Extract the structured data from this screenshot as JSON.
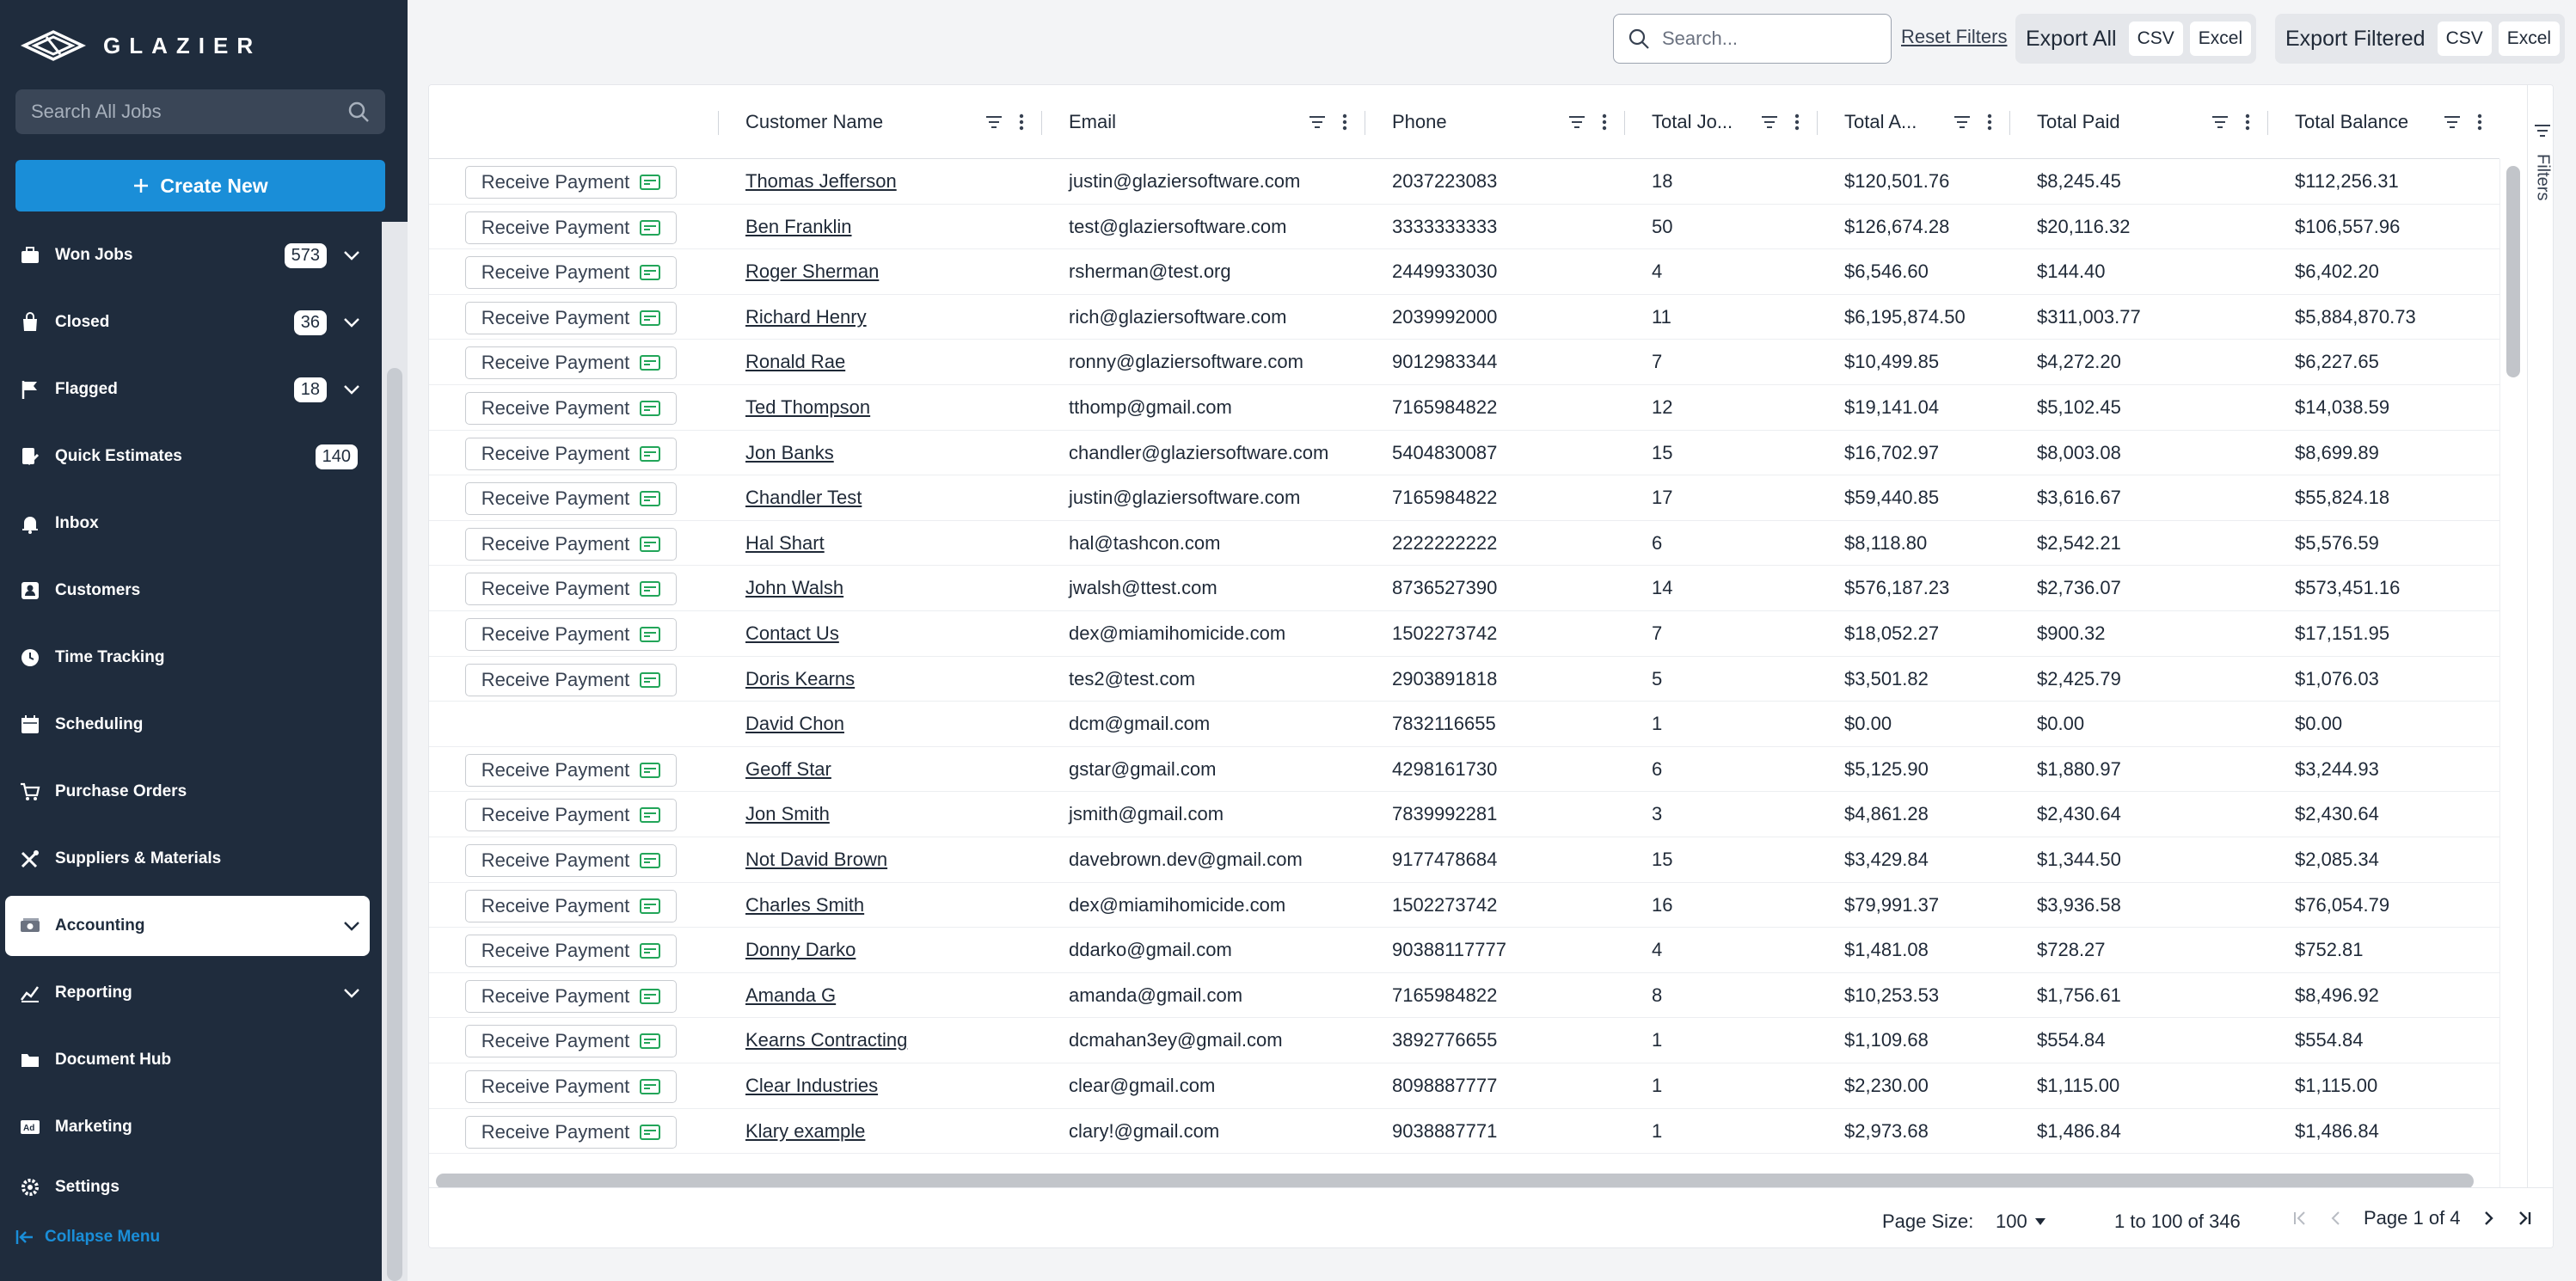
{
  "app": {
    "logo_text": "GLAZIER",
    "search_placeholder": "Search All Jobs",
    "create_label": "Create New",
    "collapse_label": "Collapse Menu"
  },
  "nav": [
    {
      "label": "Won Jobs",
      "icon": "briefcase-icon",
      "badge": "573",
      "chevron": true
    },
    {
      "label": "Closed",
      "icon": "bag-icon",
      "badge": "36",
      "chevron": true
    },
    {
      "label": "Flagged",
      "icon": "flag-icon",
      "badge": "18",
      "chevron": true
    },
    {
      "label": "Quick Estimates",
      "icon": "estimate-icon",
      "badge": "140",
      "chevron": false
    },
    {
      "label": "Inbox",
      "icon": "bell-icon",
      "badge": "",
      "chevron": false
    },
    {
      "label": "Customers",
      "icon": "customers-icon",
      "badge": "",
      "chevron": false
    },
    {
      "label": "Time Tracking",
      "icon": "clock-icon",
      "badge": "",
      "chevron": false
    },
    {
      "label": "Scheduling",
      "icon": "calendar-icon",
      "badge": "",
      "chevron": false
    },
    {
      "label": "Purchase Orders",
      "icon": "cart-icon",
      "badge": "",
      "chevron": false
    },
    {
      "label": "Suppliers & Materials",
      "icon": "tools-icon",
      "badge": "",
      "chevron": false
    },
    {
      "label": "Accounting",
      "icon": "money-icon",
      "badge": "",
      "chevron": true,
      "active": true
    },
    {
      "label": "Reporting",
      "icon": "chart-icon",
      "badge": "",
      "chevron": true
    },
    {
      "label": "Document Hub",
      "icon": "folder-icon",
      "badge": "",
      "chevron": false
    },
    {
      "label": "Marketing",
      "icon": "ad-icon",
      "badge": "",
      "chevron": false
    },
    {
      "label": "Settings",
      "icon": "gear-icon",
      "badge": "",
      "chevron": false
    }
  ],
  "toolbar": {
    "search_placeholder": "Search...",
    "reset_label": "Reset Filters",
    "export_all_label": "Export All",
    "export_filtered_label": "Export Filtered",
    "csv_label": "CSV",
    "excel_label": "Excel"
  },
  "grid": {
    "columns": [
      "",
      "Customer Name",
      "Email",
      "Phone",
      "Total Jo...",
      "Total A...",
      "Total Paid",
      "Total Balance"
    ],
    "action_label": "Receive Payment",
    "filters_tab_label": "Filters",
    "rows": [
      {
        "action": true,
        "name": "Thomas Jefferson",
        "email": "justin@glaziersoftware.com",
        "phone": "2037223083",
        "jobs": "18",
        "amount": "$120,501.76",
        "paid": "$8,245.45",
        "balance": "$112,256.31"
      },
      {
        "action": true,
        "name": "Ben Franklin",
        "email": "test@glaziersoftware.com",
        "phone": "3333333333",
        "jobs": "50",
        "amount": "$126,674.28",
        "paid": "$20,116.32",
        "balance": "$106,557.96"
      },
      {
        "action": true,
        "name": "Roger Sherman",
        "email": "rsherman@test.org",
        "phone": "2449933030",
        "jobs": "4",
        "amount": "$6,546.60",
        "paid": "$144.40",
        "balance": "$6,402.20"
      },
      {
        "action": true,
        "name": "Richard Henry",
        "email": "rich@glaziersoftware.com",
        "phone": "2039992000",
        "jobs": "11",
        "amount": "$6,195,874.50",
        "paid": "$311,003.77",
        "balance": "$5,884,870.73"
      },
      {
        "action": true,
        "name": "Ronald Rae",
        "email": "ronny@glaziersoftware.com",
        "phone": "9012983344",
        "jobs": "7",
        "amount": "$10,499.85",
        "paid": "$4,272.20",
        "balance": "$6,227.65"
      },
      {
        "action": true,
        "name": "Ted Thompson",
        "email": "tthomp@gmail.com",
        "phone": "7165984822",
        "jobs": "12",
        "amount": "$19,141.04",
        "paid": "$5,102.45",
        "balance": "$14,038.59"
      },
      {
        "action": true,
        "name": "Jon Banks",
        "email": "chandler@glaziersoftware.com",
        "phone": "5404830087",
        "jobs": "15",
        "amount": "$16,702.97",
        "paid": "$8,003.08",
        "balance": "$8,699.89"
      },
      {
        "action": true,
        "name": "Chandler Test",
        "email": "justin@glaziersoftware.com",
        "phone": "7165984822",
        "jobs": "17",
        "amount": "$59,440.85",
        "paid": "$3,616.67",
        "balance": "$55,824.18"
      },
      {
        "action": true,
        "name": "Hal Shart",
        "email": "hal@tashcon.com",
        "phone": "2222222222",
        "jobs": "6",
        "amount": "$8,118.80",
        "paid": "$2,542.21",
        "balance": "$5,576.59"
      },
      {
        "action": true,
        "name": "John Walsh",
        "email": "jwalsh@ttest.com",
        "phone": "8736527390",
        "jobs": "14",
        "amount": "$576,187.23",
        "paid": "$2,736.07",
        "balance": "$573,451.16"
      },
      {
        "action": true,
        "name": "Contact Us",
        "email": "dex@miamihomicide.com",
        "phone": "1502273742",
        "jobs": "7",
        "amount": "$18,052.27",
        "paid": "$900.32",
        "balance": "$17,151.95"
      },
      {
        "action": true,
        "name": "Doris Kearns",
        "email": "tes2@test.com",
        "phone": "2903891818",
        "jobs": "5",
        "amount": "$3,501.82",
        "paid": "$2,425.79",
        "balance": "$1,076.03"
      },
      {
        "action": false,
        "name": "David Chon",
        "email": "dcm@gmail.com",
        "phone": "7832116655",
        "jobs": "1",
        "amount": "$0.00",
        "paid": "$0.00",
        "balance": "$0.00"
      },
      {
        "action": true,
        "name": "Geoff Star",
        "email": "gstar@gmail.com",
        "phone": "4298161730",
        "jobs": "6",
        "amount": "$5,125.90",
        "paid": "$1,880.97",
        "balance": "$3,244.93"
      },
      {
        "action": true,
        "name": "Jon Smith",
        "email": "jsmith@gmail.com",
        "phone": "7839992281",
        "jobs": "3",
        "amount": "$4,861.28",
        "paid": "$2,430.64",
        "balance": "$2,430.64"
      },
      {
        "action": true,
        "name": "Not David Brown",
        "email": "davebrown.dev@gmail.com",
        "phone": "9177478684",
        "jobs": "15",
        "amount": "$3,429.84",
        "paid": "$1,344.50",
        "balance": "$2,085.34"
      },
      {
        "action": true,
        "name": "Charles Smith",
        "email": "dex@miamihomicide.com",
        "phone": "1502273742",
        "jobs": "16",
        "amount": "$79,991.37",
        "paid": "$3,936.58",
        "balance": "$76,054.79"
      },
      {
        "action": true,
        "name": "Donny Darko",
        "email": "ddarko@gmail.com",
        "phone": "90388117777",
        "jobs": "4",
        "amount": "$1,481.08",
        "paid": "$728.27",
        "balance": "$752.81"
      },
      {
        "action": true,
        "name": "Amanda G",
        "email": "amanda@gmail.com",
        "phone": "7165984822",
        "jobs": "8",
        "amount": "$10,253.53",
        "paid": "$1,756.61",
        "balance": "$8,496.92"
      },
      {
        "action": true,
        "name": "Kearns Contracting",
        "email": "dcmahan3ey@gmail.com",
        "phone": "3892776655",
        "jobs": "1",
        "amount": "$1,109.68",
        "paid": "$554.84",
        "balance": "$554.84"
      },
      {
        "action": true,
        "name": "Clear Industries",
        "email": "clear@gmail.com",
        "phone": "8098887777",
        "jobs": "1",
        "amount": "$2,230.00",
        "paid": "$1,115.00",
        "balance": "$1,115.00"
      },
      {
        "action": true,
        "name": "Klary example",
        "email": "clary!@gmail.com",
        "phone": "9038887771",
        "jobs": "1",
        "amount": "$2,973.68",
        "paid": "$1,486.84",
        "balance": "$1,486.84"
      }
    ]
  },
  "footer": {
    "page_size_label": "Page Size:",
    "page_size_value": "100",
    "range_text": "1 to 100 of 346",
    "page_text": "Page 1 of 4"
  }
}
